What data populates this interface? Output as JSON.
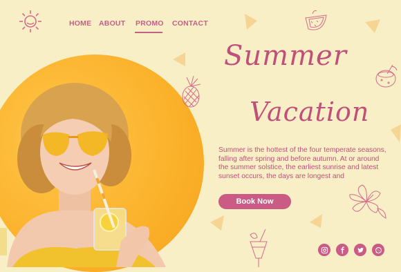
{
  "nav": {
    "items": [
      "HOME",
      "ABOUT",
      "PROMO",
      "CONTACT"
    ],
    "active": "PROMO"
  },
  "hero": {
    "title_line1": "Summer",
    "title_line2": "Vacation",
    "description": "Summer is the hottest of the four temperate seasons, falling after spring and before autumn. At or around the summer solstice, the earliest sunrise and latest sunset occurs, the days are longest and",
    "cta_label": "Book Now"
  },
  "social": [
    "instagram-icon",
    "facebook-icon",
    "twitter-icon",
    "whatsapp-icon"
  ],
  "colors": {
    "background": "#f8efc6",
    "accent": "#c95b84",
    "circle": "#fbb12a",
    "triangles": "#f5d79a"
  }
}
